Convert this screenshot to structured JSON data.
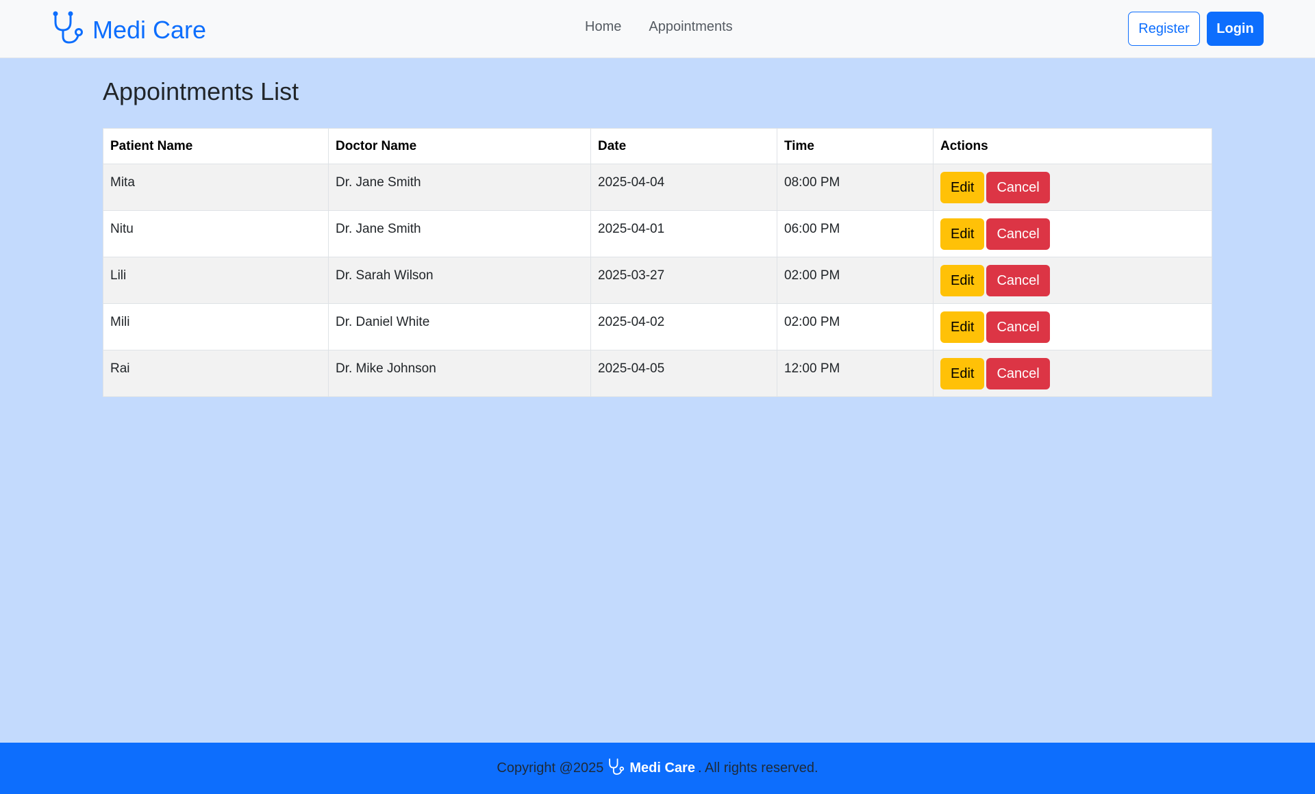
{
  "colors": {
    "page_bg": "#c3dafd",
    "navbar_bg": "#f8f9fa",
    "primary": "#0d6efd",
    "edit_button": "#ffc107",
    "cancel_button": "#dc3545",
    "footer_bg": "#0d6efd"
  },
  "navbar": {
    "brand_icon": "stethoscope-icon",
    "brand_name": "Medi Care",
    "links": [
      "Home",
      "Appointments"
    ],
    "register_label": "Register",
    "login_label": "Login"
  },
  "main": {
    "title": "Appointments List",
    "table": {
      "headers": [
        "Patient Name",
        "Doctor Name",
        "Date",
        "Time",
        "Actions"
      ],
      "rows": [
        {
          "patient": "Mita",
          "doctor": "Dr. Jane Smith",
          "date": "2025-04-04",
          "time": "08:00 PM",
          "edit_label": "Edit",
          "cancel_label": "Cancel"
        },
        {
          "patient": "Nitu",
          "doctor": "Dr. Jane Smith",
          "date": "2025-04-01",
          "time": "06:00 PM",
          "edit_label": "Edit",
          "cancel_label": "Cancel"
        },
        {
          "patient": "Lili",
          "doctor": "Dr. Sarah Wilson",
          "date": "2025-03-27",
          "time": "02:00 PM",
          "edit_label": "Edit",
          "cancel_label": "Cancel"
        },
        {
          "patient": "Mili",
          "doctor": "Dr. Daniel White",
          "date": "2025-04-02",
          "time": "02:00 PM",
          "edit_label": "Edit",
          "cancel_label": "Cancel"
        },
        {
          "patient": "Rai",
          "doctor": "Dr. Mike Johnson",
          "date": "2025-04-05",
          "time": "12:00 PM",
          "edit_label": "Edit",
          "cancel_label": "Cancel"
        }
      ]
    }
  },
  "footer": {
    "copyright": "Copyright @2025",
    "brand_icon": "stethoscope-icon",
    "brand_name": "Medi Care",
    "suffix": ". All rights reserved."
  }
}
